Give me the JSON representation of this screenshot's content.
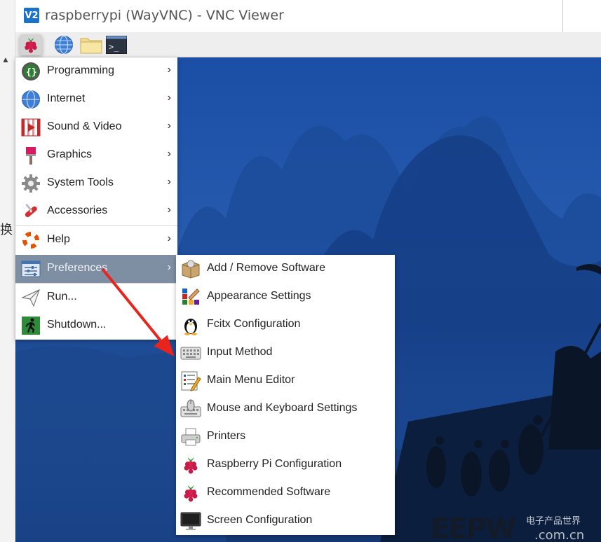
{
  "window": {
    "title": "raspberrypi (WayVNC) - VNC Viewer",
    "logo_text": "V2",
    "left_cjk_glyph": "换"
  },
  "taskbar": {
    "buttons": [
      {
        "name": "raspberry-menu",
        "icon": "raspberry-icon"
      },
      {
        "name": "web-browser",
        "icon": "globe-icon"
      },
      {
        "name": "file-manager",
        "icon": "folder-icon"
      },
      {
        "name": "terminal",
        "icon": "terminal-icon"
      }
    ]
  },
  "main_menu": {
    "items": [
      {
        "label": "Programming",
        "icon": "programming-icon",
        "submenu": true
      },
      {
        "label": "Internet",
        "icon": "globe-icon",
        "submenu": true
      },
      {
        "label": "Sound & Video",
        "icon": "video-icon",
        "submenu": true
      },
      {
        "label": "Graphics",
        "icon": "paintbrush-icon",
        "submenu": true
      },
      {
        "label": "System Tools",
        "icon": "gear-icon",
        "submenu": true
      },
      {
        "label": "Accessories",
        "icon": "swiss-knife-icon",
        "submenu": true
      },
      {
        "label": "Help",
        "icon": "lifebuoy-icon",
        "submenu": true
      },
      {
        "label": "Preferences",
        "icon": "preferences-icon",
        "submenu": true,
        "active": true
      },
      {
        "label": "Run...",
        "icon": "paper-plane-icon",
        "submenu": false
      },
      {
        "label": "Shutdown...",
        "icon": "exit-icon",
        "submenu": false
      }
    ],
    "arrow_glyph": "›"
  },
  "preferences_menu": {
    "items": [
      {
        "label": "Add / Remove Software",
        "icon": "package-icon"
      },
      {
        "label": "Appearance Settings",
        "icon": "palette-icon"
      },
      {
        "label": "Fcitx Configuration",
        "icon": "penguin-icon"
      },
      {
        "label": "Input Method",
        "icon": "keyboard-icon"
      },
      {
        "label": "Main Menu Editor",
        "icon": "menu-editor-icon"
      },
      {
        "label": "Mouse and Keyboard Settings",
        "icon": "mouse-keyboard-icon"
      },
      {
        "label": "Printers",
        "icon": "printer-icon"
      },
      {
        "label": "Raspberry Pi Configuration",
        "icon": "raspberry-icon"
      },
      {
        "label": "Recommended Software",
        "icon": "raspberry-icon"
      },
      {
        "label": "Screen Configuration",
        "icon": "monitor-icon"
      }
    ]
  },
  "watermark": {
    "brand": "EEPW",
    "cn": "电子产品世界",
    "domain": ".com.cn"
  },
  "colors": {
    "menu_active": "#7f8fa3",
    "annotation_arrow": "#e8241c",
    "desktop_blue": "#2358ad"
  }
}
